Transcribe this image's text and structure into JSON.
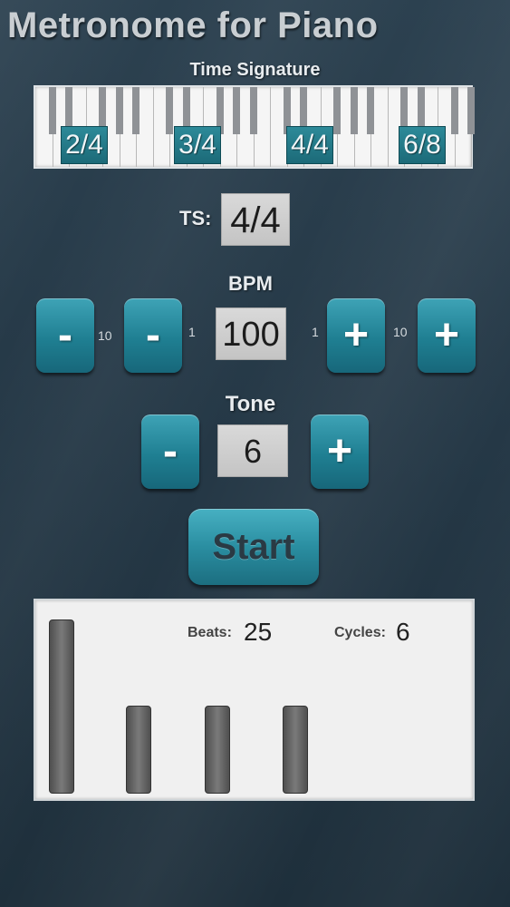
{
  "app_title": "Metronome for Piano",
  "time_signature": {
    "label": "Time Signature",
    "options": [
      "2/4",
      "3/4",
      "4/4",
      "6/8"
    ]
  },
  "ts": {
    "label": "TS:",
    "value": "4/4"
  },
  "bpm": {
    "label": "BPM",
    "value": "100",
    "minus10_label": "-",
    "minus10_step": "10",
    "minus1_label": "-",
    "minus1_step": "1",
    "plus1_label": "+",
    "plus1_step": "1",
    "plus10_label": "+",
    "plus10_step": "10"
  },
  "tone": {
    "label": "Tone",
    "value": "6",
    "minus_label": "-",
    "plus_label": "+"
  },
  "start_label": "Start",
  "stats": {
    "beats_label": "Beats:",
    "beats_value": "25",
    "cycles_label": "Cycles:",
    "cycles_value": "6"
  },
  "beat_levels": [
    1.0,
    0.5,
    0.5,
    0.5
  ],
  "colors": {
    "background": "#243745",
    "button_teal": "#1f7f92",
    "panel": "#f0f0f0"
  }
}
